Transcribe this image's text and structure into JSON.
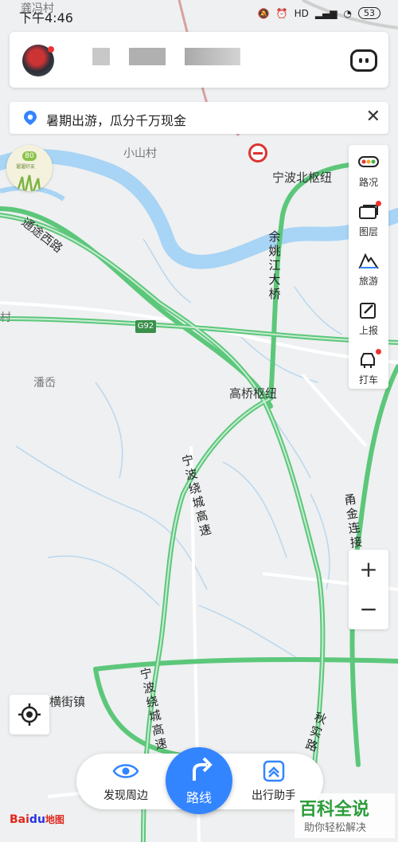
{
  "status_bar": {
    "time": "下午4:46",
    "battery": "53",
    "network": "HD"
  },
  "top_card": {
    "avatar": "avatar"
  },
  "banner": {
    "text": "暑期出游，瓜分千万现金",
    "close": "✕"
  },
  "badge": {
    "number": "80",
    "text": "遛遛好友"
  },
  "tools": [
    {
      "label": "路况",
      "icon": "traffic-light-icon"
    },
    {
      "label": "图层",
      "icon": "layers-icon"
    },
    {
      "label": "旅游",
      "icon": "travel-icon"
    },
    {
      "label": "上报",
      "icon": "report-icon"
    },
    {
      "label": "打车",
      "icon": "taxi-icon"
    }
  ],
  "zoom": {
    "in": "+",
    "out": "−"
  },
  "map_labels": {
    "xiaoshan": "小山村",
    "ningbo_north": "宁波北枢纽",
    "tongtu": "通途西路",
    "yuyao_bridge": "余姚江大桥",
    "g92": "G92",
    "panao": "潘岙",
    "gaoqiao": "高桥枢纽",
    "ring_top": "宁波绕城高速",
    "yongjin": "甬金连接线",
    "hengjie": "横街镇",
    "ring_bottom": "宁波绕城高速",
    "qiushi": "秋实路",
    "top_partial": "龚冯村",
    "left_partial": "村"
  },
  "bottom_bar": {
    "discover": "发现周边",
    "route": "路线",
    "assistant": "出行助手"
  },
  "brand": {
    "baidu_a": "Bai",
    "baidu_b": "du",
    "baidu_c": "地图"
  },
  "watermark": {
    "title": "百科全说",
    "sub": "助你轻松解决"
  },
  "colors": {
    "road": "#5cc77a",
    "water": "#a8d4f5",
    "accent": "#3385ff"
  }
}
